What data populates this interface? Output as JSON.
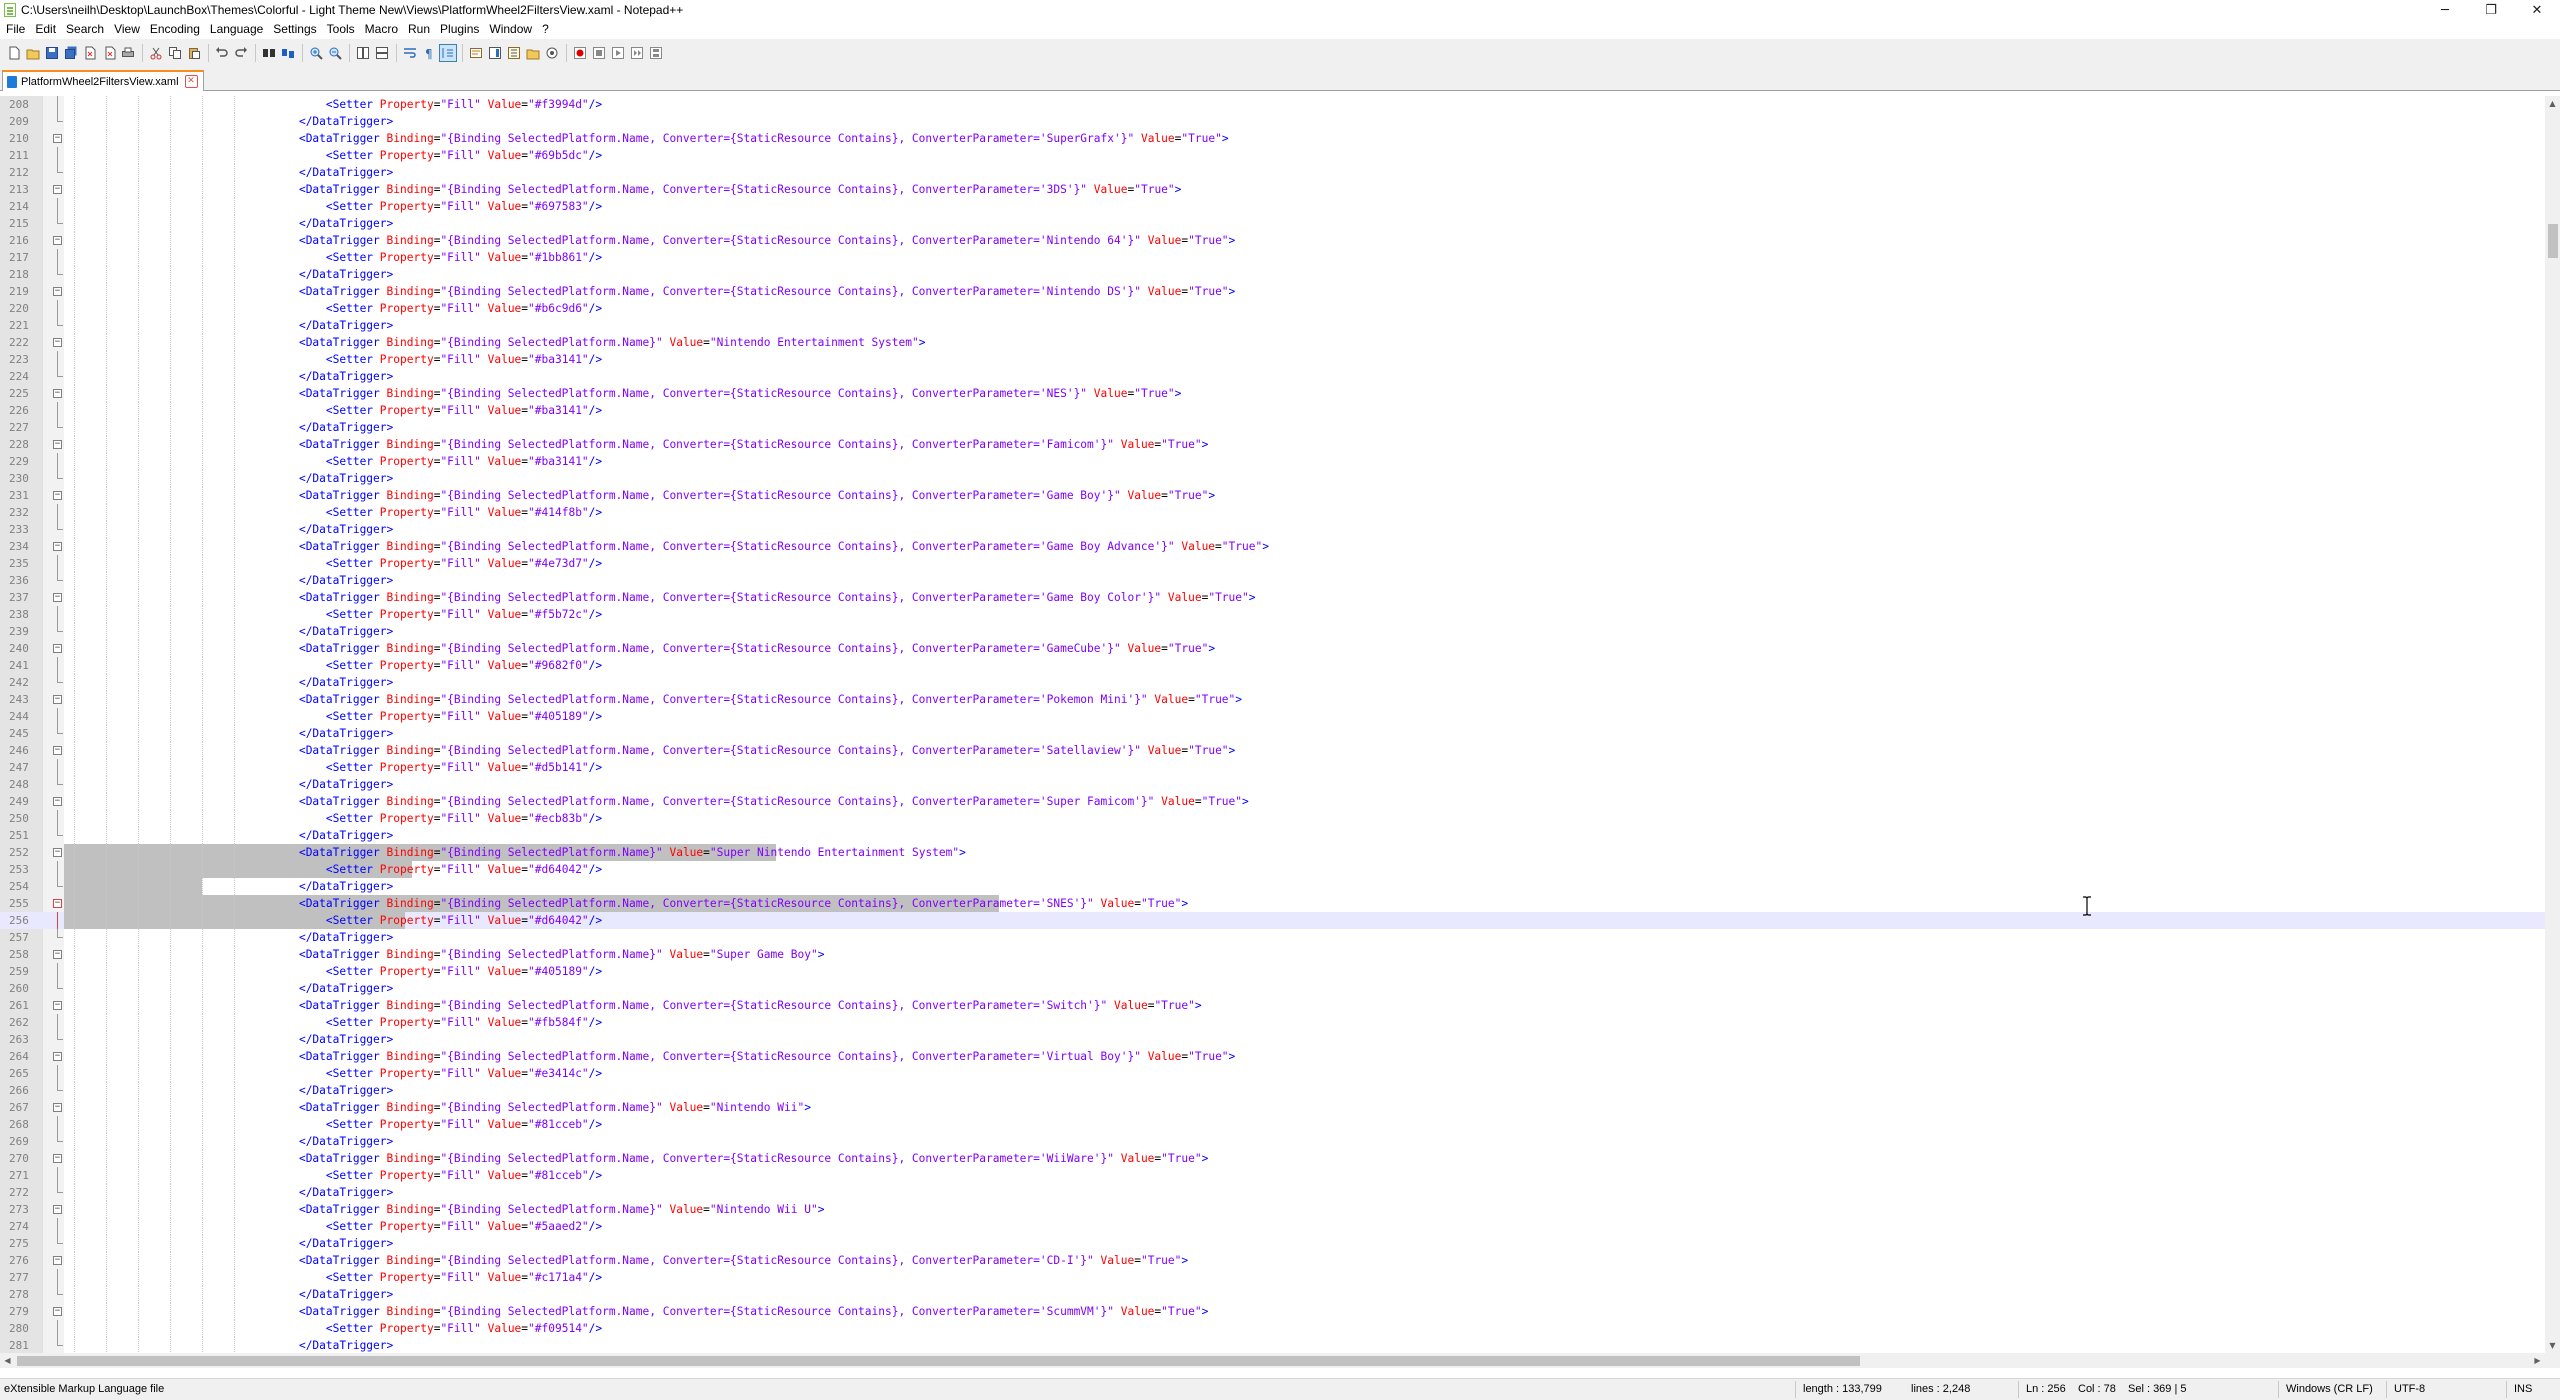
{
  "window": {
    "title": "C:\\Users\\neilh\\Desktop\\LaunchBox\\Themes\\Colorful - Light Theme New\\Views\\PlatformWheel2FiltersView.xaml - Notepad++",
    "minimize_glyph": "─",
    "maximize_glyph": "❐",
    "close_glyph": "✕"
  },
  "menu": [
    "File",
    "Edit",
    "Search",
    "View",
    "Encoding",
    "Language",
    "Settings",
    "Tools",
    "Macro",
    "Run",
    "Plugins",
    "Window",
    "?"
  ],
  "toolbar": {
    "icons": [
      "new-file-icon",
      "open-file-icon",
      "save-icon",
      "save-all-icon",
      "close-icon",
      "close-all-icon",
      "print-icon",
      "cut-icon",
      "copy-icon",
      "paste-icon",
      "undo-icon",
      "redo-icon",
      "find-icon",
      "replace-icon",
      "zoom-in-icon",
      "zoom-out-icon",
      "sync-vertical-icon",
      "sync-horizontal-icon",
      "word-wrap-icon",
      "show-all-chars-icon",
      "indent-guide-icon",
      "udl-icon",
      "doc-map-icon",
      "function-list-icon",
      "folder-workspace-icon",
      "monitoring-icon",
      "record-macro-icon",
      "stop-record-icon",
      "play-macro-icon",
      "run-macro-multiple-icon",
      "save-macro-icon"
    ]
  },
  "tab": {
    "label": "PlatformWheel2FiltersView.xaml",
    "close_glyph": "✕"
  },
  "editor": {
    "first_line": 208,
    "current_line": 256,
    "selected_lines": [
      252,
      253,
      254,
      255,
      256
    ],
    "lines": [
      {
        "n": 208,
        "code": "        <Setter Property=\"Fill\" Value=\"#f3994d\"/>"
      },
      {
        "n": 209,
        "code": "    </DataTrigger>"
      },
      {
        "n": 210,
        "code": "    <DataTrigger Binding=\"{Binding SelectedPlatform.Name, Converter={StaticResource Contains}, ConverterParameter='SuperGrafx'}\" Value=\"True\">"
      },
      {
        "n": 211,
        "code": "        <Setter Property=\"Fill\" Value=\"#69b5dc\"/>"
      },
      {
        "n": 212,
        "code": "    </DataTrigger>"
      },
      {
        "n": 213,
        "code": "    <DataTrigger Binding=\"{Binding SelectedPlatform.Name, Converter={StaticResource Contains}, ConverterParameter='3DS'}\" Value=\"True\">"
      },
      {
        "n": 214,
        "code": "        <Setter Property=\"Fill\" Value=\"#697583\"/>"
      },
      {
        "n": 215,
        "code": "    </DataTrigger>"
      },
      {
        "n": 216,
        "code": "    <DataTrigger Binding=\"{Binding SelectedPlatform.Name, Converter={StaticResource Contains}, ConverterParameter='Nintendo 64'}\" Value=\"True\">"
      },
      {
        "n": 217,
        "code": "        <Setter Property=\"Fill\" Value=\"#1bb861\"/>"
      },
      {
        "n": 218,
        "code": "    </DataTrigger>"
      },
      {
        "n": 219,
        "code": "    <DataTrigger Binding=\"{Binding SelectedPlatform.Name, Converter={StaticResource Contains}, ConverterParameter='Nintendo DS'}\" Value=\"True\">"
      },
      {
        "n": 220,
        "code": "        <Setter Property=\"Fill\" Value=\"#b6c9d6\"/>"
      },
      {
        "n": 221,
        "code": "    </DataTrigger>"
      },
      {
        "n": 222,
        "code": "    <DataTrigger Binding=\"{Binding SelectedPlatform.Name}\" Value=\"Nintendo Entertainment System\">"
      },
      {
        "n": 223,
        "code": "        <Setter Property=\"Fill\" Value=\"#ba3141\"/>"
      },
      {
        "n": 224,
        "code": "    </DataTrigger>"
      },
      {
        "n": 225,
        "code": "    <DataTrigger Binding=\"{Binding SelectedPlatform.Name, Converter={StaticResource Contains}, ConverterParameter='NES'}\" Value=\"True\">"
      },
      {
        "n": 226,
        "code": "        <Setter Property=\"Fill\" Value=\"#ba3141\"/>"
      },
      {
        "n": 227,
        "code": "    </DataTrigger>"
      },
      {
        "n": 228,
        "code": "    <DataTrigger Binding=\"{Binding SelectedPlatform.Name, Converter={StaticResource Contains}, ConverterParameter='Famicom'}\" Value=\"True\">"
      },
      {
        "n": 229,
        "code": "        <Setter Property=\"Fill\" Value=\"#ba3141\"/>"
      },
      {
        "n": 230,
        "code": "    </DataTrigger>"
      },
      {
        "n": 231,
        "code": "    <DataTrigger Binding=\"{Binding SelectedPlatform.Name, Converter={StaticResource Contains}, ConverterParameter='Game Boy'}\" Value=\"True\">"
      },
      {
        "n": 232,
        "code": "        <Setter Property=\"Fill\" Value=\"#414f8b\"/>"
      },
      {
        "n": 233,
        "code": "    </DataTrigger>"
      },
      {
        "n": 234,
        "code": "    <DataTrigger Binding=\"{Binding SelectedPlatform.Name, Converter={StaticResource Contains}, ConverterParameter='Game Boy Advance'}\" Value=\"True\">"
      },
      {
        "n": 235,
        "code": "        <Setter Property=\"Fill\" Value=\"#4e73d7\"/>"
      },
      {
        "n": 236,
        "code": "    </DataTrigger>"
      },
      {
        "n": 237,
        "code": "    <DataTrigger Binding=\"{Binding SelectedPlatform.Name, Converter={StaticResource Contains}, ConverterParameter='Game Boy Color'}\" Value=\"True\">"
      },
      {
        "n": 238,
        "code": "        <Setter Property=\"Fill\" Value=\"#f5b72c\"/>"
      },
      {
        "n": 239,
        "code": "    </DataTrigger>"
      },
      {
        "n": 240,
        "code": "    <DataTrigger Binding=\"{Binding SelectedPlatform.Name, Converter={StaticResource Contains}, ConverterParameter='GameCube'}\" Value=\"True\">"
      },
      {
        "n": 241,
        "code": "        <Setter Property=\"Fill\" Value=\"#9682f0\"/>"
      },
      {
        "n": 242,
        "code": "    </DataTrigger>"
      },
      {
        "n": 243,
        "code": "    <DataTrigger Binding=\"{Binding SelectedPlatform.Name, Converter={StaticResource Contains}, ConverterParameter='Pokemon Mini'}\" Value=\"True\">"
      },
      {
        "n": 244,
        "code": "        <Setter Property=\"Fill\" Value=\"#405189\"/>"
      },
      {
        "n": 245,
        "code": "    </DataTrigger>"
      },
      {
        "n": 246,
        "code": "    <DataTrigger Binding=\"{Binding SelectedPlatform.Name, Converter={StaticResource Contains}, ConverterParameter='Satellaview'}\" Value=\"True\">"
      },
      {
        "n": 247,
        "code": "        <Setter Property=\"Fill\" Value=\"#d5b141\"/>"
      },
      {
        "n": 248,
        "code": "    </DataTrigger>"
      },
      {
        "n": 249,
        "code": "    <DataTrigger Binding=\"{Binding SelectedPlatform.Name, Converter={StaticResource Contains}, ConverterParameter='Super Famicom'}\" Value=\"True\">"
      },
      {
        "n": 250,
        "code": "        <Setter Property=\"Fill\" Value=\"#ecb83b\"/>"
      },
      {
        "n": 251,
        "code": "    </DataTrigger>"
      },
      {
        "n": 252,
        "code": "    <DataTrigger Binding=\"{Binding SelectedPlatform.Name}\" Value=\"Super Nintendo Entertainment System\">"
      },
      {
        "n": 253,
        "code": "        <Setter Property=\"Fill\" Value=\"#d64042\"/>"
      },
      {
        "n": 254,
        "code": "    </DataTrigger>"
      },
      {
        "n": 255,
        "code": "    <DataTrigger Binding=\"{Binding SelectedPlatform.Name, Converter={StaticResource Contains}, ConverterParameter='SNES'}\" Value=\"True\">"
      },
      {
        "n": 256,
        "code": "        <Setter Property=\"Fill\" Value=\"#d64042\"/>"
      },
      {
        "n": 257,
        "code": "    </DataTrigger>"
      },
      {
        "n": 258,
        "code": "    <DataTrigger Binding=\"{Binding SelectedPlatform.Name}\" Value=\"Super Game Boy\">"
      },
      {
        "n": 259,
        "code": "        <Setter Property=\"Fill\" Value=\"#405189\"/>"
      },
      {
        "n": 260,
        "code": "    </DataTrigger>"
      },
      {
        "n": 261,
        "code": "    <DataTrigger Binding=\"{Binding SelectedPlatform.Name, Converter={StaticResource Contains}, ConverterParameter='Switch'}\" Value=\"True\">"
      },
      {
        "n": 262,
        "code": "        <Setter Property=\"Fill\" Value=\"#fb584f\"/>"
      },
      {
        "n": 263,
        "code": "    </DataTrigger>"
      },
      {
        "n": 264,
        "code": "    <DataTrigger Binding=\"{Binding SelectedPlatform.Name, Converter={StaticResource Contains}, ConverterParameter='Virtual Boy'}\" Value=\"True\">"
      },
      {
        "n": 265,
        "code": "        <Setter Property=\"Fill\" Value=\"#e3414c\"/>"
      },
      {
        "n": 266,
        "code": "    </DataTrigger>"
      },
      {
        "n": 267,
        "code": "    <DataTrigger Binding=\"{Binding SelectedPlatform.Name}\" Value=\"Nintendo Wii\">"
      },
      {
        "n": 268,
        "code": "        <Setter Property=\"Fill\" Value=\"#81cceb\"/>"
      },
      {
        "n": 269,
        "code": "    </DataTrigger>"
      },
      {
        "n": 270,
        "code": "    <DataTrigger Binding=\"{Binding SelectedPlatform.Name, Converter={StaticResource Contains}, ConverterParameter='WiiWare'}\" Value=\"True\">"
      },
      {
        "n": 271,
        "code": "        <Setter Property=\"Fill\" Value=\"#81cceb\"/>"
      },
      {
        "n": 272,
        "code": "    </DataTrigger>"
      },
      {
        "n": 273,
        "code": "    <DataTrigger Binding=\"{Binding SelectedPlatform.Name}\" Value=\"Nintendo Wii U\">"
      },
      {
        "n": 274,
        "code": "        <Setter Property=\"Fill\" Value=\"#5aaed2\"/>"
      },
      {
        "n": 275,
        "code": "    </DataTrigger>"
      },
      {
        "n": 276,
        "code": "    <DataTrigger Binding=\"{Binding SelectedPlatform.Name, Converter={StaticResource Contains}, ConverterParameter='CD-I'}\" Value=\"True\">"
      },
      {
        "n": 277,
        "code": "        <Setter Property=\"Fill\" Value=\"#c171a4\"/>"
      },
      {
        "n": 278,
        "code": "    </DataTrigger>"
      },
      {
        "n": 279,
        "code": "    <DataTrigger Binding=\"{Binding SelectedPlatform.Name, Converter={StaticResource Contains}, ConverterParameter='ScummVM'}\" Value=\"True\">"
      },
      {
        "n": 280,
        "code": "        <Setter Property=\"Fill\" Value=\"#f09514\"/>"
      },
      {
        "n": 281,
        "code": "    </DataTrigger>"
      }
    ]
  },
  "status": {
    "file_type": "eXtensible Markup Language file",
    "length": "length : 133,799",
    "lines": "lines : 2,248",
    "ln": "Ln : 256",
    "col": "Col : 78",
    "sel": "Sel : 369 | 5",
    "eol": "Windows (CR LF)",
    "encoding": "UTF-8",
    "mode": "INS"
  },
  "colors": {
    "tag": "#0000ff",
    "attr": "#ff0000",
    "value": "#8000ff",
    "tab_accent": "#fa8c1e",
    "selection": "#c0c0c0",
    "current_line": "#e8e8ff"
  }
}
